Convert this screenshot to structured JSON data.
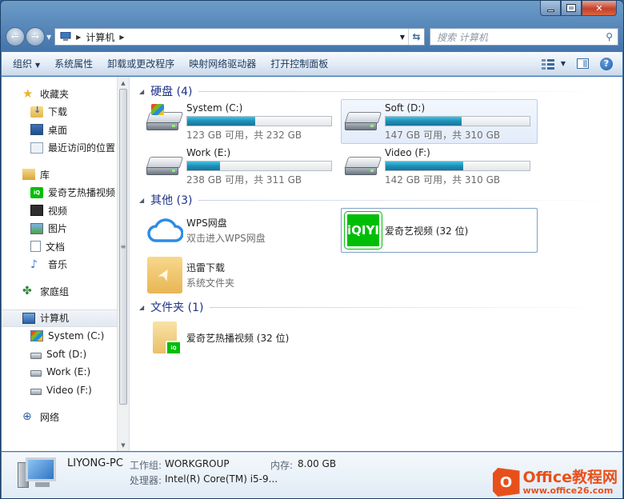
{
  "address": {
    "path": [
      "计算机"
    ],
    "search_placeholder": "搜索 计算机"
  },
  "toolbar": {
    "organize": "组织",
    "system_properties": "系统属性",
    "uninstall": "卸载或更改程序",
    "map_drive": "映射网络驱动器",
    "control_panel": "打开控制面板"
  },
  "nav": {
    "favorites": "收藏夹",
    "downloads": "下载",
    "desktop": "桌面",
    "recent": "最近访问的位置",
    "libraries": "库",
    "iqiyi_lib": "爱奇艺热播视频",
    "videos": "视频",
    "pictures": "图片",
    "documents": "文档",
    "music": "音乐",
    "homegroup": "家庭组",
    "computer": "计算机",
    "drive_c": "System (C:)",
    "drive_d": "Soft (D:)",
    "drive_e": "Work (E:)",
    "drive_f": "Video (F:)",
    "network": "网络"
  },
  "groups": {
    "drives": "硬盘 (4)",
    "other": "其他 (3)",
    "folders": "文件夹 (1)"
  },
  "drives": [
    {
      "name": "System (C:)",
      "info": "123 GB 可用，共 232 GB",
      "used_fraction": 0.47
    },
    {
      "name": "Soft (D:)",
      "info": "147 GB 可用，共 310 GB",
      "used_fraction": 0.53
    },
    {
      "name": "Work (E:)",
      "info": "238 GB 可用，共 311 GB",
      "used_fraction": 0.23
    },
    {
      "name": "Video (F:)",
      "info": "142 GB 可用，共 310 GB",
      "used_fraction": 0.54
    }
  ],
  "other": [
    {
      "name": "WPS网盘",
      "sub": "双击进入WPS网盘"
    },
    {
      "name": "爱奇艺视频 (32 位)",
      "sub": ""
    },
    {
      "name": "迅雷下载",
      "sub": "系统文件夹"
    }
  ],
  "folders": [
    {
      "name": "爱奇艺热播视频 (32 位)"
    }
  ],
  "details": {
    "pc_name": "LIYONG-PC",
    "workgroup_label": "工作组:",
    "workgroup": "WORKGROUP",
    "memory_label": "内存:",
    "memory": "8.00 GB",
    "cpu_label": "处理器:",
    "cpu": "Intel(R) Core(TM) i5-9..."
  },
  "watermark": {
    "title": "Office教程网",
    "url": "www.office26.com",
    "logo_letter": "O"
  },
  "colors": {
    "bar_fill": "#1f8fb5",
    "group_header": "#1e3287",
    "iqiyi": "#00be06",
    "watermark": "#e8501b"
  }
}
